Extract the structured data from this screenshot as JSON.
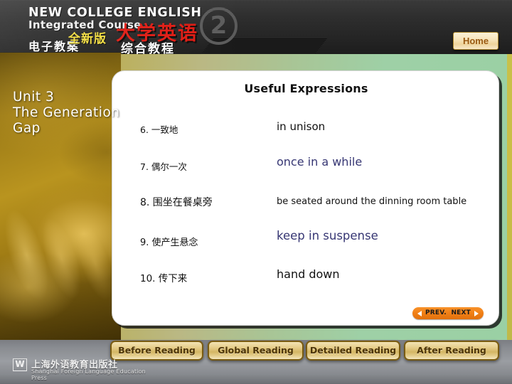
{
  "header": {
    "brand_line1": "NEW COLLEGE ENGLISH",
    "brand_line2": "Integrated Course",
    "brand_line3": "电子教案",
    "cn_edition": "全新版",
    "cn_title": "大学英语",
    "cn_subtitle": "综合教程",
    "volume_number": "2",
    "home_label": "Home"
  },
  "sidebar": {
    "unit_line1": "Unit 3",
    "unit_line2": "The  Generation",
    "unit_line3": "Gap"
  },
  "panel": {
    "title": "Useful Expressions",
    "rows": [
      {
        "cn": "6. 一致地",
        "en": "in unison"
      },
      {
        "cn": "7. 偶尔一次",
        "en": "once in a while"
      },
      {
        "cn": "8. 围坐在餐桌旁",
        "en": "be seated around the dinning room table"
      },
      {
        "cn": "9. 使产生悬念",
        "en": "keep in suspense"
      },
      {
        "cn": "10. 传下来",
        "en": "hand down"
      }
    ],
    "nav": {
      "prev_label": "PREV.",
      "next_label": "NEXT"
    }
  },
  "tabs": [
    {
      "label": "Before Reading"
    },
    {
      "label": "Global Reading"
    },
    {
      "label": "Detailed Reading"
    },
    {
      "label": "After Reading"
    }
  ],
  "footer": {
    "logo_mark": "W",
    "publisher_cn": "上海外语教育出版社",
    "publisher_en": "Shanghai Foreign Language Education Press"
  },
  "colors": {
    "accent_orange": "#f0811a",
    "title_red": "#e01b13",
    "edition_yellow": "#f2dc3c",
    "tab_gold": "#d4b664",
    "navy_text": "#363673",
    "panel_bg": "#ffffff"
  }
}
